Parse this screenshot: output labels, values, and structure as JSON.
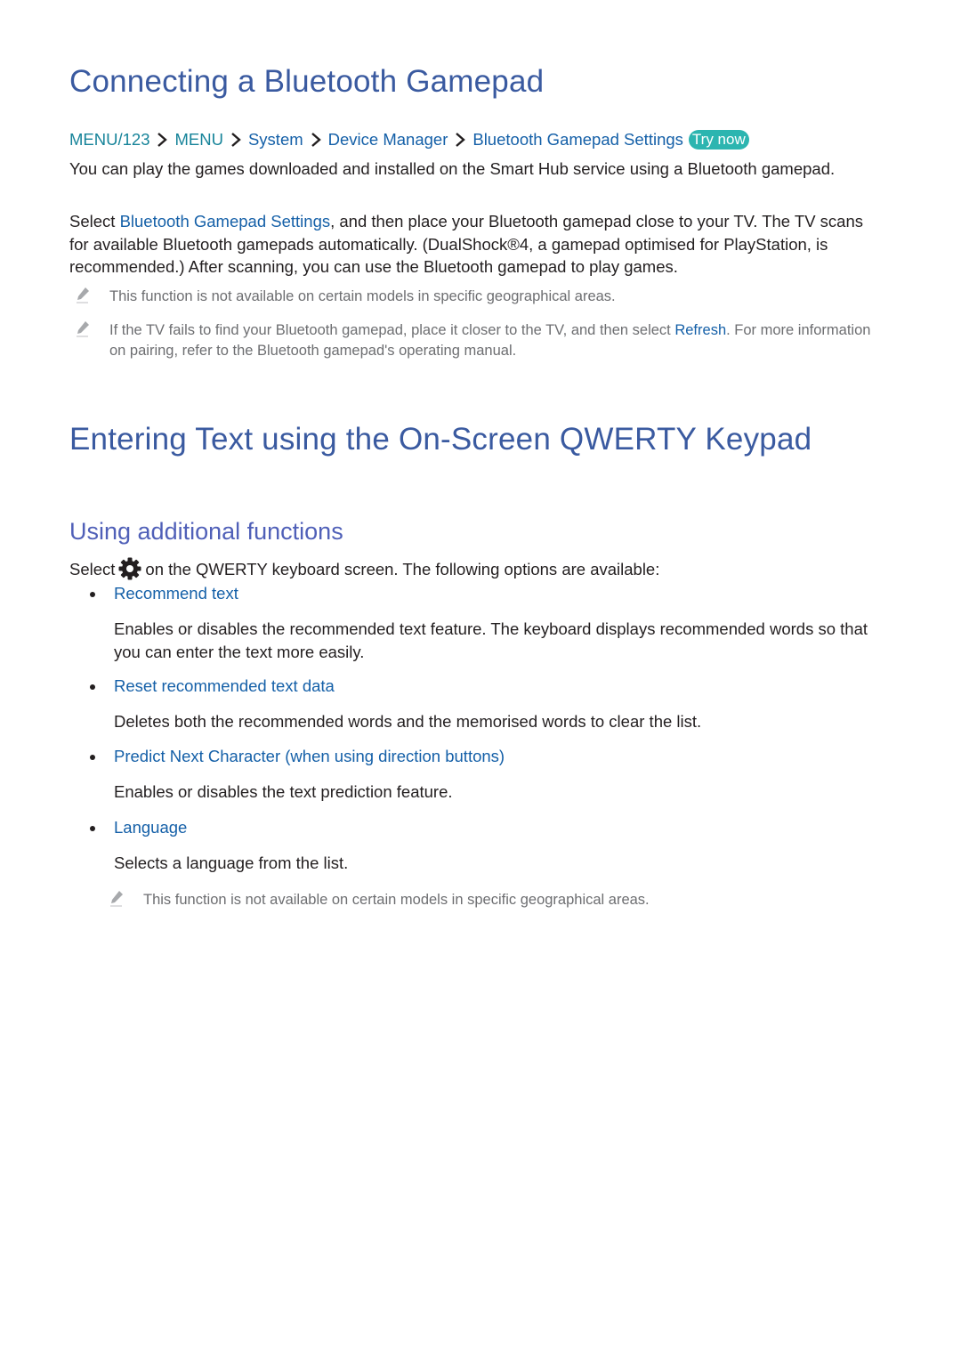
{
  "section1": {
    "title": "Connecting a Bluetooth Gamepad",
    "breadcrumb": [
      {
        "label": "MENU/123",
        "style": "teal"
      },
      {
        "label": "MENU",
        "style": "teal"
      },
      {
        "label": "System",
        "style": "blue"
      },
      {
        "label": "Device Manager",
        "style": "blue"
      },
      {
        "label": "Bluetooth Gamepad Settings",
        "style": "blue"
      }
    ],
    "try_now_label": "Try now",
    "intro": "You can play the games downloaded and installed on the Smart Hub service using a Bluetooth gamepad.",
    "instructions": {
      "prefix": "Select ",
      "link": "Bluetooth Gamepad Settings",
      "suffix": ", and then place your Bluetooth gamepad close to your TV. The TV scans for available Bluetooth gamepads automatically. (DualShock®4, a gamepad optimised for PlayStation, is recommended.) After scanning, you can use the Bluetooth gamepad to play games."
    },
    "notes": [
      {
        "icon": "pencil-icon",
        "text": "This function is not available on certain models in specific geographical areas."
      },
      {
        "icon": "pencil-icon",
        "prefix": "If the TV fails to find your Bluetooth gamepad, place it closer to the TV, and then select ",
        "link": "Refresh",
        "suffix": ". For more information on pairing, refer to the Bluetooth gamepad's operating manual."
      }
    ]
  },
  "section2": {
    "title": "Entering Text using the On-Screen QWERTY Keypad",
    "subsection": {
      "title": "Using additional functions",
      "intro_prefix": "Select",
      "intro_icon": "gear-icon",
      "intro_suffix": "on the QWERTY keyboard screen. The following options are available:",
      "options": [
        {
          "title": "Recommend text",
          "description": "Enables or disables the recommended text feature. The keyboard displays recommended words so that you can enter the text more easily."
        },
        {
          "title": "Reset recommended text data",
          "description": "Deletes both the recommended words and the memorised words to clear the list."
        },
        {
          "title": "Predict Next Character (when using direction buttons)",
          "description": "Enables or disables the text prediction feature."
        },
        {
          "title": "Language",
          "description": "Selects a language from the list."
        }
      ],
      "note": {
        "icon": "pencil-icon",
        "text": "This function is not available on certain models in specific geographical areas."
      }
    }
  },
  "colors": {
    "heading": "#3a5aa0",
    "subheading": "#5060b8",
    "link": "#1560a8",
    "breadcrumb_teal": "#17849a",
    "try_now_bg": "#2cb5b0",
    "note_text": "#6d6e71",
    "body_text": "#231f20"
  }
}
